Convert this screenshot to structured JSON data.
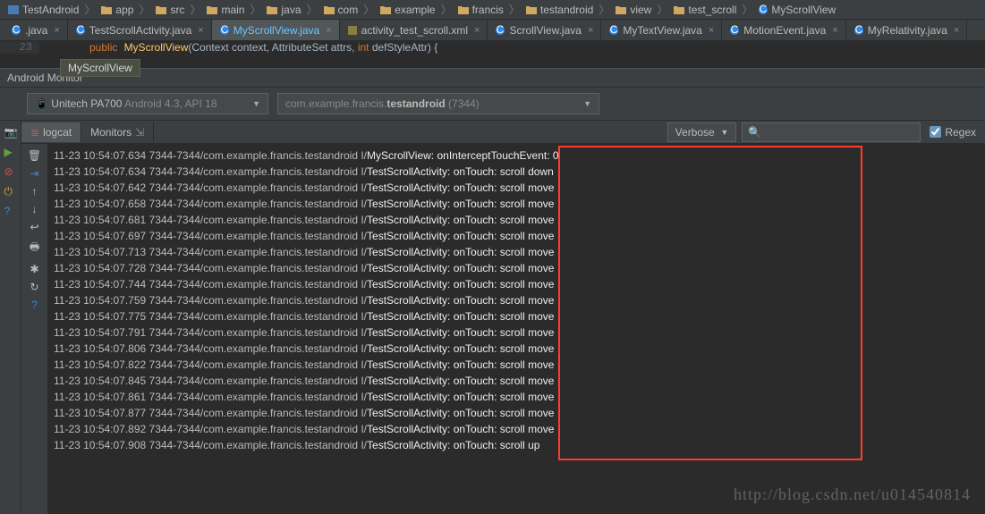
{
  "breadcrumb": [
    {
      "icon": "project",
      "label": "TestAndroid"
    },
    {
      "icon": "folder",
      "label": "app"
    },
    {
      "icon": "folder",
      "label": "src"
    },
    {
      "icon": "folder",
      "label": "main"
    },
    {
      "icon": "folder",
      "label": "java"
    },
    {
      "icon": "folder",
      "label": "com"
    },
    {
      "icon": "folder",
      "label": "example"
    },
    {
      "icon": "folder",
      "label": "francis"
    },
    {
      "icon": "folder",
      "label": "testandroid"
    },
    {
      "icon": "folder",
      "label": "view"
    },
    {
      "icon": "folder",
      "label": "test_scroll"
    },
    {
      "icon": "class",
      "label": "MyScrollView"
    }
  ],
  "tabs": [
    {
      "icon": "java",
      "label": ".java",
      "active": false
    },
    {
      "icon": "class",
      "label": "TestScrollActivity.java",
      "active": false
    },
    {
      "icon": "class",
      "label": "MyScrollView.java",
      "active": true
    },
    {
      "icon": "xml",
      "label": "activity_test_scroll.xml",
      "active": false
    },
    {
      "icon": "class",
      "label": "ScrollView.java",
      "active": false
    },
    {
      "icon": "class",
      "label": "MyTextView.java",
      "active": false
    },
    {
      "icon": "class",
      "label": "MotionEvent.java",
      "active": false
    },
    {
      "icon": "class",
      "label": "MyRelativity.java",
      "active": false
    }
  ],
  "tooltip": "MyScrollView",
  "editor": {
    "line_no": "23",
    "kw1": "public",
    "cls": "MyScrollView",
    "open": "(",
    "p1": "Context context",
    "c": ", ",
    "p2": "AttributeSet attrs",
    "c2": ", ",
    "kw2": "int",
    "p3": " defStyleAttr",
    "close": ") {"
  },
  "tool_window_title": "Android Monitor",
  "device_combo": {
    "text": "Unitech PA700",
    "sub": "Android 4.3, API 18"
  },
  "process_combo": {
    "pre": "com.example.francis.",
    "bold": "testandroid",
    "suf": " (7344)"
  },
  "tool_tabs": {
    "logcat": "logcat",
    "monitors": "Monitors"
  },
  "verbose_label": "Verbose",
  "search_placeholder": "",
  "regex_label": "Regex",
  "log": {
    "prefix": "11-23 10:54:07.",
    "mid": " 7344-7344/com.example.francis.testandroid I/",
    "rows": [
      {
        "ms": "634",
        "msg": "MyScrollView: onInterceptTouchEvent: 0"
      },
      {
        "ms": "634",
        "msg": "TestScrollActivity: onTouch: scroll down"
      },
      {
        "ms": "642",
        "msg": "TestScrollActivity: onTouch: scroll move"
      },
      {
        "ms": "658",
        "msg": "TestScrollActivity: onTouch: scroll move"
      },
      {
        "ms": "681",
        "msg": "TestScrollActivity: onTouch: scroll move"
      },
      {
        "ms": "697",
        "msg": "TestScrollActivity: onTouch: scroll move"
      },
      {
        "ms": "713",
        "msg": "TestScrollActivity: onTouch: scroll move"
      },
      {
        "ms": "728",
        "msg": "TestScrollActivity: onTouch: scroll move"
      },
      {
        "ms": "744",
        "msg": "TestScrollActivity: onTouch: scroll move"
      },
      {
        "ms": "759",
        "msg": "TestScrollActivity: onTouch: scroll move"
      },
      {
        "ms": "775",
        "msg": "TestScrollActivity: onTouch: scroll move"
      },
      {
        "ms": "791",
        "msg": "TestScrollActivity: onTouch: scroll move"
      },
      {
        "ms": "806",
        "msg": "TestScrollActivity: onTouch: scroll move"
      },
      {
        "ms": "822",
        "msg": "TestScrollActivity: onTouch: scroll move"
      },
      {
        "ms": "845",
        "msg": "TestScrollActivity: onTouch: scroll move"
      },
      {
        "ms": "861",
        "msg": "TestScrollActivity: onTouch: scroll move"
      },
      {
        "ms": "877",
        "msg": "TestScrollActivity: onTouch: scroll move"
      },
      {
        "ms": "892",
        "msg": "TestScrollActivity: onTouch: scroll move"
      },
      {
        "ms": "908",
        "msg": "TestScrollActivity: onTouch: scroll up"
      }
    ]
  },
  "watermark": "http://blog.csdn.net/u014540814"
}
